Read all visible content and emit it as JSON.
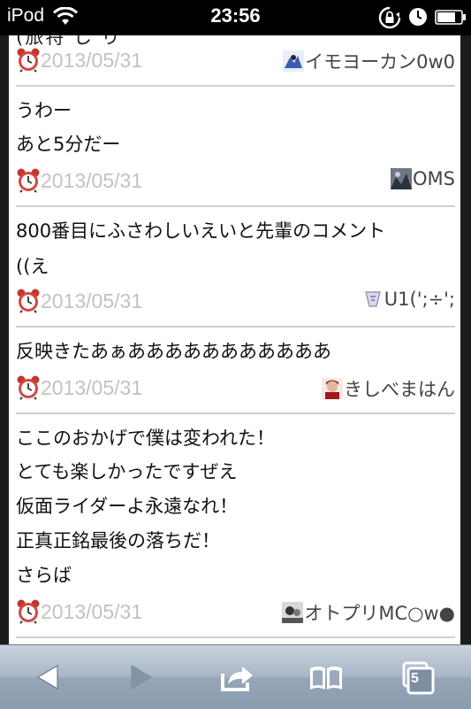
{
  "status_bar": {
    "carrier": "iPod",
    "time": "23:56"
  },
  "page": {
    "cut_text": "(旅特 し り     ",
    "comments": [
      {
        "lines": [],
        "date": "2013/05/31",
        "author": "イモヨーカン0w0",
        "avatar_icon": "avatar-blue-icon"
      },
      {
        "lines": [
          "うわー",
          "あと5分だー"
        ],
        "date": "2013/05/31",
        "author": "OMS",
        "avatar_icon": "avatar-dark-icon"
      },
      {
        "lines": [
          "800番目にふさわしいえいと先輩のコメント",
          "((え"
        ],
        "date": "2013/05/31",
        "author": "U1(';÷';",
        "avatar_icon": "avatar-light-icon"
      },
      {
        "lines": [
          "反映きたあぁあああああああああああ"
        ],
        "date": "2013/05/31",
        "author": "きしべまはん",
        "avatar_icon": "avatar-red-icon"
      },
      {
        "lines": [
          "ここのおかげで僕は変われた！",
          "とても楽しかったですぜえ",
          "仮面ライダーよ永遠なれ！",
          "正真正銘最後の落ちだ！",
          "さらば"
        ],
        "date": "2013/05/31",
        "author": "オトプリMC○w●",
        "avatar_icon": "avatar-photo-icon"
      }
    ]
  },
  "toolbar": {
    "tabs_count": "5",
    "buttons": [
      "back",
      "forward",
      "share",
      "bookmarks",
      "tabs"
    ]
  },
  "colors": {
    "date_text": "#c2c2c2",
    "toolbar_top": "#c9d3de",
    "toolbar_bottom": "#8a9bb0"
  }
}
